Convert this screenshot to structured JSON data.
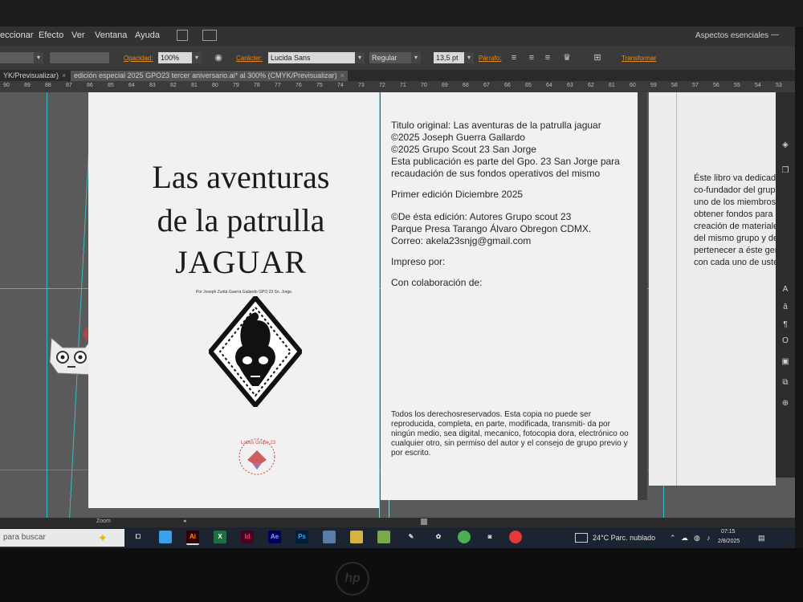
{
  "menu": {
    "items": [
      "eccionar",
      "Efecto",
      "Ver",
      "Ventana",
      "Ayuda"
    ],
    "workspace_label": "Aspectos esenciales"
  },
  "control": {
    "opacity_label": "Opacidad:",
    "opacity_value": "100%",
    "character_label": "Carácter:",
    "font_name": "Lucida Sans",
    "font_style": "Regular",
    "font_size": "13,5 pt",
    "paragraph_label": "Párrafo:",
    "transform_label": "Transformar"
  },
  "tabs": {
    "tab1": "YK/Previsualizar)",
    "tab2": "edición especial 2025 GPO23 tercer aniversario.ai* al 300% (CMYK/Previsualizar)",
    "close": "×"
  },
  "ruler_ticks": [
    "90",
    "89",
    "88",
    "87",
    "86",
    "85",
    "84",
    "83",
    "82",
    "81",
    "80",
    "79",
    "78",
    "77",
    "76",
    "75",
    "74",
    "73",
    "72",
    "71",
    "70",
    "69",
    "68",
    "67",
    "66",
    "65",
    "64",
    "63",
    "62",
    "61",
    "60",
    "59",
    "58",
    "57",
    "56",
    "55",
    "54",
    "53",
    "52"
  ],
  "cover": {
    "title_line1": "Las aventuras",
    "title_line2": "de la patrulla",
    "title_line3": "JAGUAR",
    "author": "Por Joseph Zuritá Guerra Gallardo GPO 23 Sn. Jorge.",
    "logo_text": "Lobos Grupo 23"
  },
  "credits": {
    "block1": "Titulo original: Las aventuras de la patrulla jaguar\n©2025 Joseph Guerra Gallardo\n©2025 Grupo Scout 23 San Jorge\nEsta publicación es parte del Gpo. 23 San Jorge para\nrecaudación de sus fondos operativos del mismo",
    "edition": "Primer edición Diciembre 2025",
    "block2": "©De ésta edición: Autores Grupo scout 23\nParque Presa Tarango Álvaro Obregon CDMX.\nCorreo: akela23snjg@gmail.com",
    "printed_by": "Impreso por:",
    "collab": "Con colaboración de:",
    "rights": "Todos los derechosreservados. Esta copia no puede ser reproducida, completa, en parte, modificada, transmiti- da por ningún medio, sea digital, mecanico, fotocopia dora, electrónico oo cualquier otro, sin permiso del autor y el consejo de grupo previo y por escrito."
  },
  "dedication": {
    "text": "Éste libro va dedicad\nco-fundador del grupo\nuno de los miembros d\nobtener fondos para su\ncreación de materiales\ndel mismo grupo y desp\npertenecer a éste genial\ncon cada uno de ustede"
  },
  "status": {
    "zoom_label": "Zoom"
  },
  "taskbar": {
    "search_placeholder": "para buscar",
    "apps": [
      "Ai",
      "X",
      "Id",
      "Ae",
      "Ps"
    ],
    "weather": "24°C  Parc. nublado",
    "time": "07:15",
    "date": "2/8/2025"
  },
  "colors": {
    "illustrator_orange": "#e58a1f",
    "guide_cyan": "#33c7d6",
    "logo_red": "#c94545"
  }
}
